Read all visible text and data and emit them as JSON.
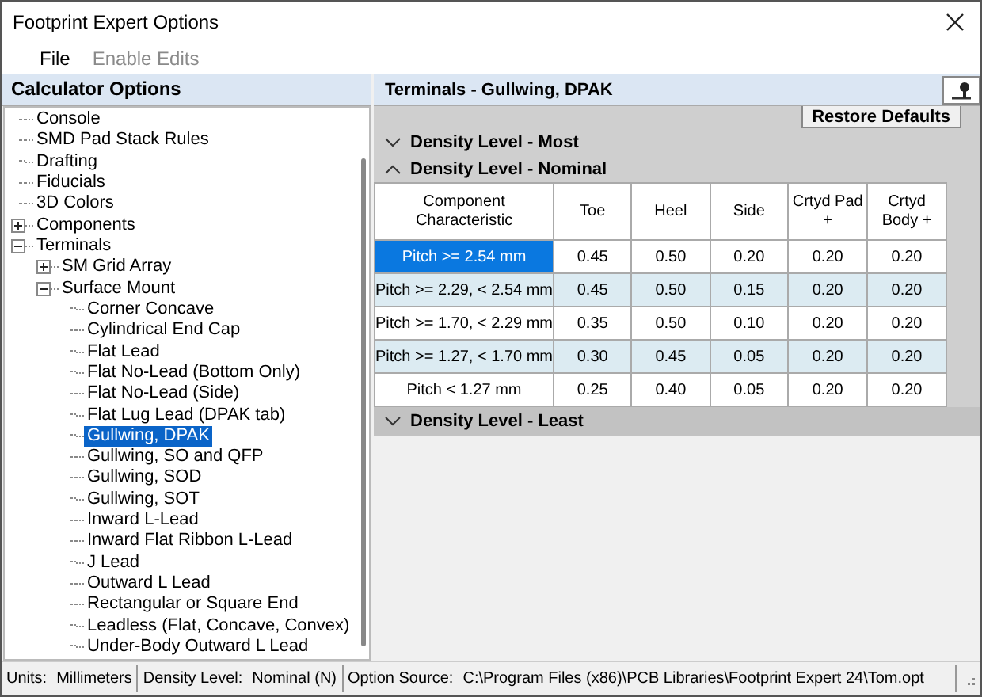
{
  "window": {
    "title": "Footprint Expert Options"
  },
  "menu": [
    {
      "label": "File",
      "disabled": false
    },
    {
      "label": "Enable Edits",
      "disabled": true
    }
  ],
  "sidebar": {
    "title": "Calculator Options",
    "tree": [
      {
        "label": "Console",
        "selected": false
      },
      {
        "label": "SMD Pad Stack Rules",
        "selected": false
      },
      {
        "label": "Drafting",
        "selected": false
      },
      {
        "label": "Fiducials",
        "selected": false
      },
      {
        "label": "3D Colors",
        "selected": false
      },
      {
        "label": "Components",
        "selected": false,
        "expanded": false
      },
      {
        "label": "Terminals",
        "selected": false,
        "expanded": true,
        "children": [
          {
            "label": "SM Grid Array",
            "selected": false,
            "expanded": false
          },
          {
            "label": "Surface Mount",
            "selected": false,
            "expanded": true,
            "children": [
              {
                "label": "Corner Concave",
                "selected": false
              },
              {
                "label": "Cylindrical End Cap",
                "selected": false
              },
              {
                "label": "Flat Lead",
                "selected": false
              },
              {
                "label": "Flat No-Lead (Bottom Only)",
                "selected": false
              },
              {
                "label": "Flat No-Lead (Side)",
                "selected": false
              },
              {
                "label": "Flat Lug Lead (DPAK tab)",
                "selected": false
              },
              {
                "label": "Gullwing, DPAK",
                "selected": true
              },
              {
                "label": "Gullwing, SO and QFP",
                "selected": false
              },
              {
                "label": "Gullwing, SOD",
                "selected": false
              },
              {
                "label": "Gullwing, SOT",
                "selected": false
              },
              {
                "label": "Inward L-Lead",
                "selected": false
              },
              {
                "label": "Inward Flat Ribbon L-Lead",
                "selected": false
              },
              {
                "label": "J Lead",
                "selected": false
              },
              {
                "label": "Outward L Lead",
                "selected": false
              },
              {
                "label": "Rectangular or Square End",
                "selected": false
              },
              {
                "label": "Leadless (Flat, Concave, Convex)",
                "selected": false
              },
              {
                "label": "Under-Body Outward L Lead",
                "selected": false
              }
            ]
          }
        ]
      }
    ]
  },
  "panel": {
    "title": "Terminals - Gullwing, DPAK",
    "restore_button": "Restore Defaults",
    "sections": [
      {
        "title": "Density Level - Most",
        "expanded": false
      },
      {
        "title": "Density Level - Nominal",
        "expanded": true,
        "table": {
          "columns": [
            "Component Characteristic",
            "Toe",
            "Heel",
            "Side",
            "Crtyd Pad +",
            "Crtyd Body +"
          ],
          "rows": [
            {
              "selected": true,
              "cells": [
                "Pitch >= 2.54 mm",
                "0.45",
                "0.50",
                "0.20",
                "0.20",
                "0.20"
              ]
            },
            {
              "selected": false,
              "cells": [
                "Pitch >= 2.29, < 2.54 mm",
                "0.45",
                "0.50",
                "0.15",
                "0.20",
                "0.20"
              ]
            },
            {
              "selected": false,
              "cells": [
                "Pitch >= 1.70, < 2.29 mm",
                "0.35",
                "0.50",
                "0.10",
                "0.20",
                "0.20"
              ]
            },
            {
              "selected": false,
              "cells": [
                "Pitch >= 1.27, < 1.70 mm",
                "0.30",
                "0.45",
                "0.05",
                "0.20",
                "0.20"
              ]
            },
            {
              "selected": false,
              "cells": [
                "Pitch < 1.27 mm",
                "0.25",
                "0.40",
                "0.05",
                "0.20",
                "0.20"
              ]
            }
          ]
        }
      },
      {
        "title": "Density Level - Least",
        "expanded": false
      }
    ]
  },
  "status_bar": [
    {
      "label": "Units:",
      "value": "Millimeters"
    },
    {
      "label": "Density Level:",
      "value": "Nominal (N)"
    },
    {
      "label": "Option Source:",
      "value": "C:\\Program Files (x86)\\PCB Libraries\\Footprint Expert 24\\Tom.opt"
    }
  ]
}
